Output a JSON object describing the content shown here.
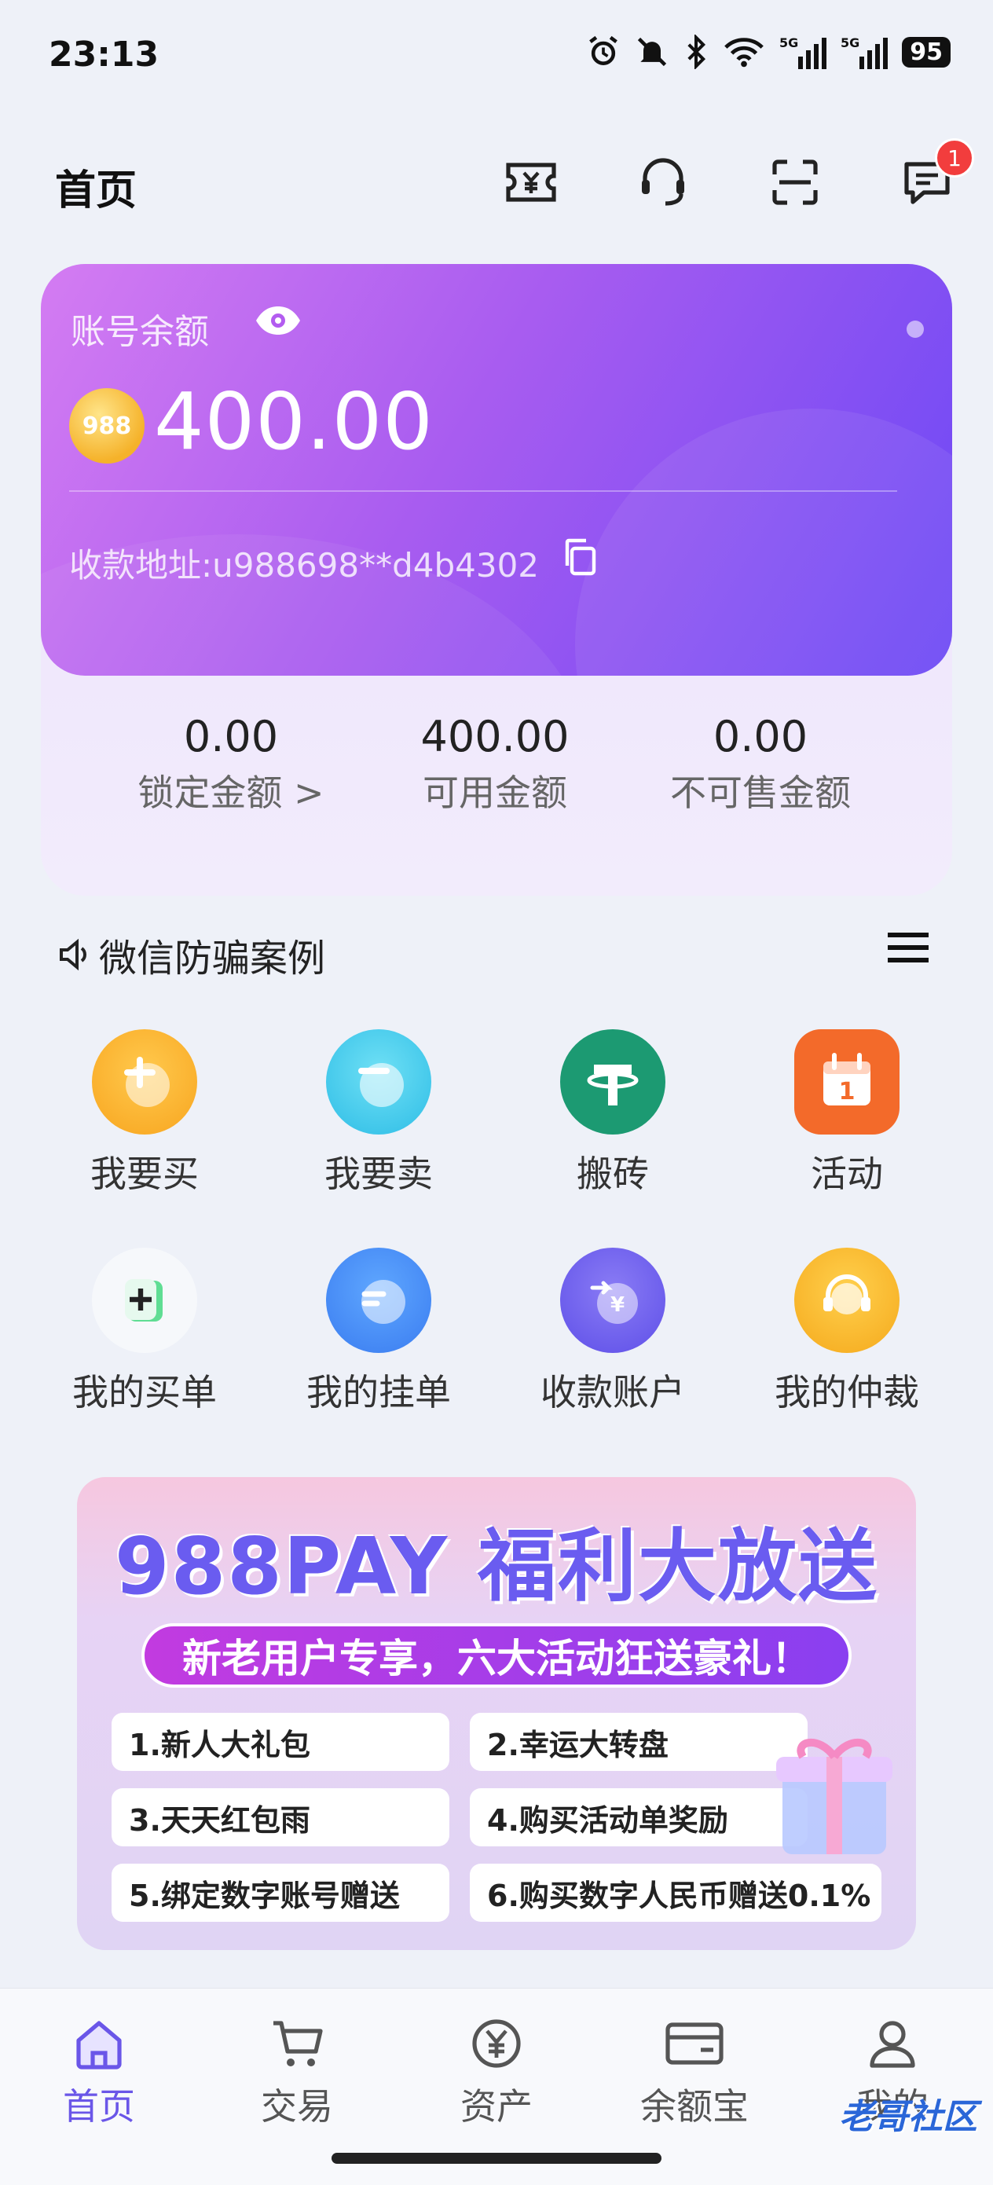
{
  "status_bar": {
    "time": "23:13",
    "battery": "95"
  },
  "header": {
    "title": "首页",
    "message_badge": "1"
  },
  "balance_card": {
    "label": "账号余额",
    "coin_text": "988",
    "amount": "400.00",
    "address": "收款地址:u988698**d4b4302"
  },
  "stats": [
    {
      "value": "0.00",
      "label": "锁定金额 >"
    },
    {
      "value": "400.00",
      "label": "可用金额"
    },
    {
      "value": "0.00",
      "label": "不可售金额"
    }
  ],
  "notice": {
    "text": "微信防骗案例"
  },
  "grid": [
    {
      "label": "我要买",
      "icon": "plus-coin-icon"
    },
    {
      "label": "我要卖",
      "icon": "minus-coin-icon"
    },
    {
      "label": "搬砖",
      "icon": "tether-icon"
    },
    {
      "label": "活动",
      "icon": "calendar-icon"
    },
    {
      "label": "我的买单",
      "icon": "buy-order-icon"
    },
    {
      "label": "我的挂单",
      "icon": "sell-order-icon"
    },
    {
      "label": "收款账户",
      "icon": "receive-account-icon"
    },
    {
      "label": "我的仲裁",
      "icon": "arbitration-icon"
    }
  ],
  "banner": {
    "title": "988PAY 福利大放送",
    "subtitle": "新老用户专享，六大活动狂送豪礼！",
    "items": [
      "1.新人大礼包",
      "2.幸运大转盘",
      "3.天天红包雨",
      "4.购买活动单奖励",
      "5.绑定数字账号赠送",
      "6.购买数字人民币赠送0.1%"
    ]
  },
  "nav": [
    {
      "label": "首页",
      "active": true
    },
    {
      "label": "交易"
    },
    {
      "label": "资产"
    },
    {
      "label": "余额宝"
    },
    {
      "label": "我的"
    }
  ],
  "watermark": "老哥社区",
  "colors": {
    "accent": "#6a56e8",
    "card_start": "#d47cf2",
    "card_end": "#6b48f5",
    "badge": "#f23d3d"
  }
}
